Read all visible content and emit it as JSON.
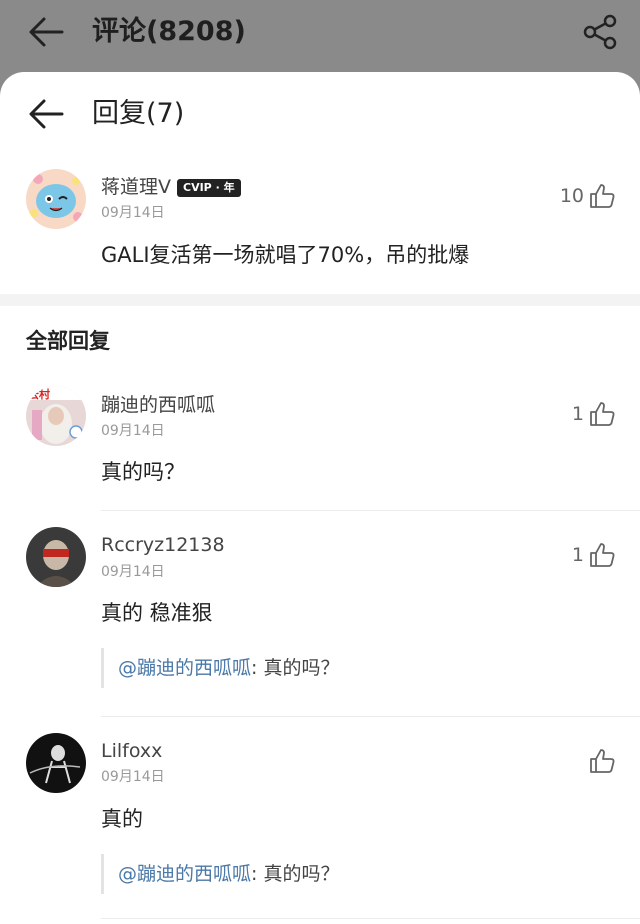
{
  "topbar": {
    "title": "评论(8208)"
  },
  "sheet": {
    "title": "回复(7)"
  },
  "main_comment": {
    "user": "蒋道理V",
    "badge": "CVIP · 年",
    "date": "09月14日",
    "likes": "10",
    "text": "GALI复活第一场就唱了70%，吊的批爆"
  },
  "section_title": "全部回复",
  "replies": [
    {
      "user": "蹦迪的西呱呱",
      "date": "09月14日",
      "likes": "1",
      "text": "真的吗？"
    },
    {
      "user": "Rccryz12138",
      "date": "09月14日",
      "likes": "1",
      "text": "真的 稳准狠",
      "quote": {
        "mention": "@蹦迪的西呱呱",
        "text": ": 真的吗？"
      }
    },
    {
      "user": "Lilfoxx",
      "date": "09月14日",
      "likes": "",
      "text": "真的",
      "quote": {
        "mention": "@蹦迪的西呱呱",
        "text": ": 真的吗？"
      }
    }
  ],
  "icons": {
    "back": "back-arrow-icon",
    "share": "share-icon",
    "like": "thumbs-up-icon"
  },
  "colors": {
    "backdrop": "#8a8a8a",
    "mention": "#4a78a8",
    "divider": "#ececec"
  }
}
